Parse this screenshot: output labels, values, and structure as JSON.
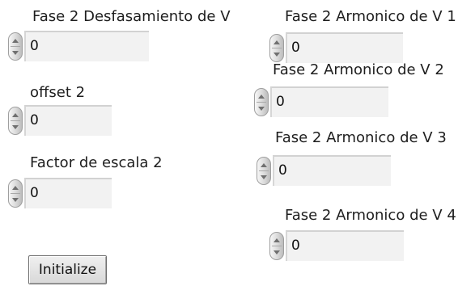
{
  "controls": {
    "fase_desfasamiento": {
      "label": "Fase 2 Desfasamiento de V",
      "value": "0"
    },
    "offset": {
      "label": "offset 2",
      "value": "0"
    },
    "factor_escala": {
      "label": "Factor de escala 2",
      "value": "0"
    },
    "armonico_1": {
      "label": "Fase 2 Armonico de V 1",
      "value": "0"
    },
    "armonico_2": {
      "label": "Fase 2 Armonico de V 2",
      "value": "0"
    },
    "armonico_3": {
      "label": "Fase 2 Armonico de V 3",
      "value": "0"
    },
    "armonico_4": {
      "label": "Fase 2 Armonico de V 4",
      "value": "0"
    }
  },
  "buttons": {
    "initialize": "Initialize"
  }
}
